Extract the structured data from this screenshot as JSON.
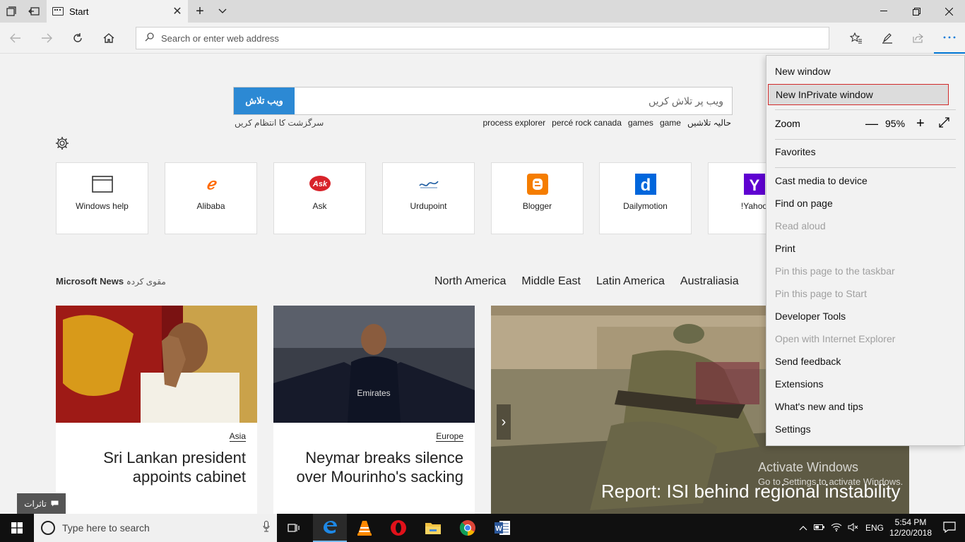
{
  "tab": {
    "title": "Start"
  },
  "address": {
    "placeholder": "Search or enter web address"
  },
  "search": {
    "button": "ویب تلاش",
    "placeholder": "ویب پر تلاش کریں",
    "manage_history": "سرگزشت کا انتظام کریں"
  },
  "trends": [
    "process explorer",
    "percé rock canada",
    "games",
    "game",
    "حالیہ تلاشیں"
  ],
  "tiles": [
    {
      "label": "Windows help",
      "icon": "window-icon",
      "color": "#333333"
    },
    {
      "label": "Alibaba",
      "icon": "alibaba-logo",
      "color": "#ff6a00"
    },
    {
      "label": "Ask",
      "icon": "ask-logo",
      "color": "#d8232a"
    },
    {
      "label": "Urdupoint",
      "icon": "urdupoint-logo",
      "color": "#1a5aa0"
    },
    {
      "label": "Blogger",
      "icon": "blogger-logo",
      "color": "#f57d00"
    },
    {
      "label": "Dailymotion",
      "icon": "dailymotion-logo",
      "color": "#0066dc"
    },
    {
      "label": "!Yahoo",
      "icon": "yahoo-logo",
      "color": "#5f01d1"
    }
  ],
  "news": {
    "title": "Microsoft News",
    "subtitle": "مقوی کردہ",
    "regions": [
      "North America",
      "Middle East",
      "Latin America",
      "Australiasia"
    ],
    "cards": [
      {
        "tag": "Asia",
        "headline": "Sri Lankan president appoints cabinet"
      },
      {
        "tag": "Europe",
        "headline": "Neymar breaks silence over Mourinho's sacking"
      },
      {
        "headline": "Report: ISI behind regional instability"
      }
    ]
  },
  "watermark": {
    "line1": "Activate Windows",
    "line2": "Go to Settings to activate Windows."
  },
  "feedback": {
    "label": "تاثرات"
  },
  "menu": {
    "new_window": "New window",
    "new_inprivate": "New InPrivate window",
    "zoom_label": "Zoom",
    "zoom_value": "95%",
    "favorites": "Favorites",
    "items": [
      {
        "label": "Cast media to device",
        "enabled": true
      },
      {
        "label": "Find on page",
        "enabled": true
      },
      {
        "label": "Read aloud",
        "enabled": false
      },
      {
        "label": "Print",
        "enabled": true
      },
      {
        "label": "Pin this page to the taskbar",
        "enabled": false
      },
      {
        "label": "Pin this page to Start",
        "enabled": false
      },
      {
        "label": "Developer Tools",
        "enabled": true
      },
      {
        "label": "Open with Internet Explorer",
        "enabled": false
      },
      {
        "label": "Send feedback",
        "enabled": true
      },
      {
        "label": "Extensions",
        "enabled": true
      },
      {
        "label": "What's new and tips",
        "enabled": true
      },
      {
        "label": "Settings",
        "enabled": true
      }
    ]
  },
  "taskbar": {
    "search_placeholder": "Type here to search",
    "language": "ENG",
    "time": "5:54 PM",
    "date": "12/20/2018"
  },
  "colors": {
    "accent": "#0078d7",
    "search_button": "#2c89d4"
  }
}
